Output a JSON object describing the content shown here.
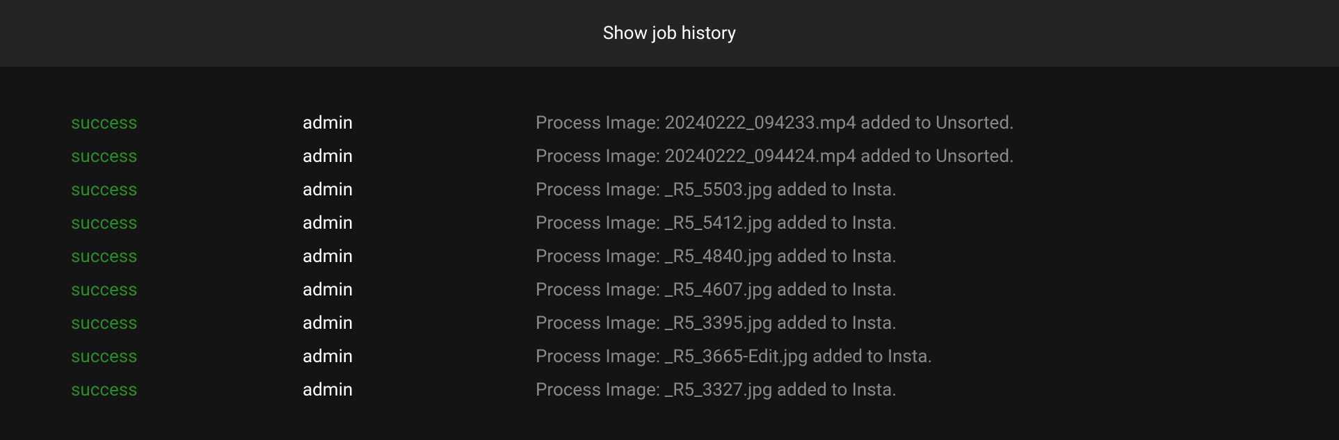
{
  "header": {
    "label": "Show job history"
  },
  "jobs": [
    {
      "status": "success",
      "user": "admin",
      "message": "Process Image: 20240222_094233.mp4 added to Unsorted."
    },
    {
      "status": "success",
      "user": "admin",
      "message": "Process Image: 20240222_094424.mp4 added to Unsorted."
    },
    {
      "status": "success",
      "user": "admin",
      "message": "Process Image: _R5_5503.jpg added to Insta."
    },
    {
      "status": "success",
      "user": "admin",
      "message": "Process Image: _R5_5412.jpg added to Insta."
    },
    {
      "status": "success",
      "user": "admin",
      "message": "Process Image: _R5_4840.jpg added to Insta."
    },
    {
      "status": "success",
      "user": "admin",
      "message": "Process Image: _R5_4607.jpg added to Insta."
    },
    {
      "status": "success",
      "user": "admin",
      "message": "Process Image: _R5_3395.jpg added to Insta."
    },
    {
      "status": "success",
      "user": "admin",
      "message": "Process Image: _R5_3665-Edit.jpg added to Insta."
    },
    {
      "status": "success",
      "user": "admin",
      "message": "Process Image: _R5_3327.jpg added to Insta."
    }
  ]
}
